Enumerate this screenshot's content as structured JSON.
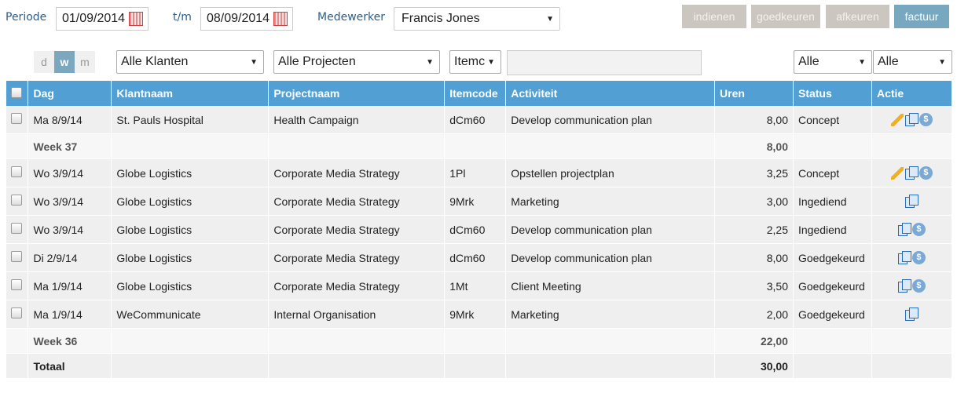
{
  "filters": {
    "periode_label": "Periode",
    "from": "01/09/2014",
    "tm_label": "t/m",
    "to": "08/09/2014",
    "medewerker_label": "Medewerker",
    "medewerker": "Francis Jones",
    "views": [
      "d",
      "w",
      "m"
    ],
    "klanten": "Alle Klanten",
    "projecten": "Alle Projecten",
    "itemcode": "Itemc",
    "status1": "Alle",
    "status2": "Alle"
  },
  "buttons": {
    "indienen": "indienen",
    "goedkeuren": "goedkeuren",
    "afkeuren": "afkeuren",
    "factuur": "factuur"
  },
  "table": {
    "headers": [
      "Dag",
      "Klantnaam",
      "Projectnaam",
      "Itemcode",
      "Activiteit",
      "Uren",
      "Status",
      "Actie"
    ],
    "rows": [
      {
        "type": "item",
        "dag": "Ma 8/9/14",
        "klant": "St. Pauls Hospital",
        "project": "Health Campaign",
        "item": "dCm60",
        "act": "Develop communication plan",
        "uren": "8,00",
        "status": "Concept",
        "icons": [
          "pencil-icon",
          "copy-icon",
          "dollar-icon"
        ]
      },
      {
        "type": "week",
        "label": "Week 37",
        "uren": "8,00"
      },
      {
        "type": "item",
        "dag": "Wo 3/9/14",
        "klant": "Globe Logistics",
        "project": "Corporate Media Strategy",
        "item": "1Pl",
        "act": "Opstellen projectplan",
        "uren": "3,25",
        "status": "Concept",
        "icons": [
          "pencil-icon",
          "copy-icon",
          "dollar-icon"
        ]
      },
      {
        "type": "item",
        "dag": "Wo 3/9/14",
        "klant": "Globe Logistics",
        "project": "Corporate Media Strategy",
        "item": "9Mrk",
        "act": "Marketing",
        "uren": "3,00",
        "status": "Ingediend",
        "icons": [
          "copy-icon"
        ]
      },
      {
        "type": "item",
        "dag": "Wo 3/9/14",
        "klant": "Globe Logistics",
        "project": "Corporate Media Strategy",
        "item": "dCm60",
        "act": "Develop communication plan",
        "uren": "2,25",
        "status": "Ingediend",
        "icons": [
          "copy-icon",
          "dollar-icon"
        ]
      },
      {
        "type": "item",
        "dag": "Di 2/9/14",
        "klant": "Globe Logistics",
        "project": "Corporate Media Strategy",
        "item": "dCm60",
        "act": "Develop communication plan",
        "uren": "8,00",
        "status": "Goedgekeurd",
        "icons": [
          "copy-icon",
          "dollar-icon"
        ]
      },
      {
        "type": "item",
        "dag": "Ma 1/9/14",
        "klant": "Globe Logistics",
        "project": "Corporate Media Strategy",
        "item": "1Mt",
        "act": "Client Meeting",
        "uren": "3,50",
        "status": "Goedgekeurd",
        "icons": [
          "copy-icon",
          "dollar-icon"
        ]
      },
      {
        "type": "item",
        "dag": "Ma 1/9/14",
        "klant": "WeCommunicate",
        "project": "Internal Organisation",
        "item": "9Mrk",
        "act": "Marketing",
        "uren": "2,00",
        "status": "Goedgekeurd",
        "icons": [
          "copy-icon"
        ]
      },
      {
        "type": "week",
        "label": "Week 36",
        "uren": "22,00"
      },
      {
        "type": "total",
        "label": "Totaal",
        "uren": "30,00"
      }
    ]
  }
}
